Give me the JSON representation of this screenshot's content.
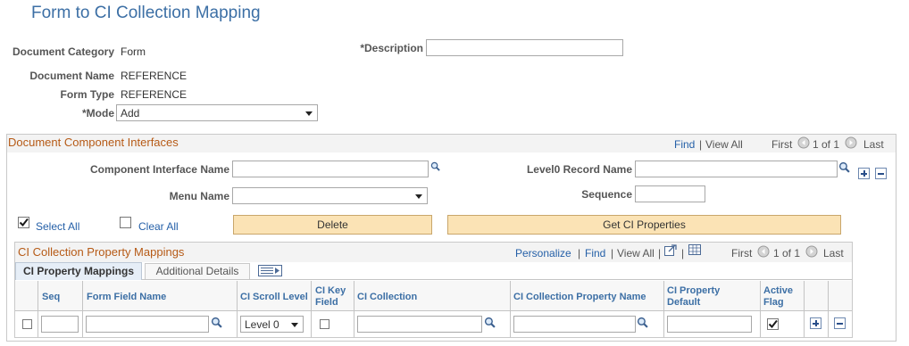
{
  "page": {
    "title": "Form to CI Collection Mapping"
  },
  "header": {
    "document_category_label": "Document Category",
    "document_category_value": "Form",
    "description_label": "*Description",
    "description_value": "",
    "document_name_label": "Document Name",
    "document_name_value": "REFERENCE",
    "form_type_label": "Form Type",
    "form_type_value": "REFERENCE",
    "mode_label": "*Mode",
    "mode_value": "Add"
  },
  "dci": {
    "title": "Document Component Interfaces",
    "find": "Find",
    "sep": "|",
    "view_all": "View All",
    "first": "First",
    "count": "1 of 1",
    "last": "Last",
    "ci_name_label": "Component Interface Name",
    "ci_name_value": "",
    "level0_label": "Level0 Record Name",
    "level0_value": "",
    "menu_name_label": "Menu Name",
    "menu_name_value": "",
    "sequence_label": "Sequence",
    "sequence_value": "",
    "select_all": "Select All",
    "clear_all": "Clear All",
    "delete_button": "Delete",
    "get_ci_button": "Get CI Properties"
  },
  "cpm": {
    "title": "CI Collection Property Mappings",
    "personalize": "Personalize",
    "find": "Find",
    "view_all": "View All",
    "sep": "|",
    "first": "First",
    "count": "1 of 1",
    "last": "Last",
    "tabs": [
      "CI Property Mappings",
      "Additional Details"
    ],
    "columns": {
      "seq": "Seq",
      "form_field": "Form Field Name",
      "scroll_level": "CI Scroll Level",
      "key_field_1": "CI Key",
      "key_field_2": "Field",
      "collection": "CI Collection",
      "prop_name": "CI Collection Property Name",
      "prop_default_1": "CI Property",
      "prop_default_2": "Default",
      "active_1": "Active",
      "active_2": "Flag"
    },
    "row": {
      "seq": "",
      "form_field": "",
      "scroll_level": "Level 0",
      "key_field_checked": false,
      "collection": "",
      "prop_name": "",
      "prop_default": "",
      "active_checked": true
    }
  }
}
